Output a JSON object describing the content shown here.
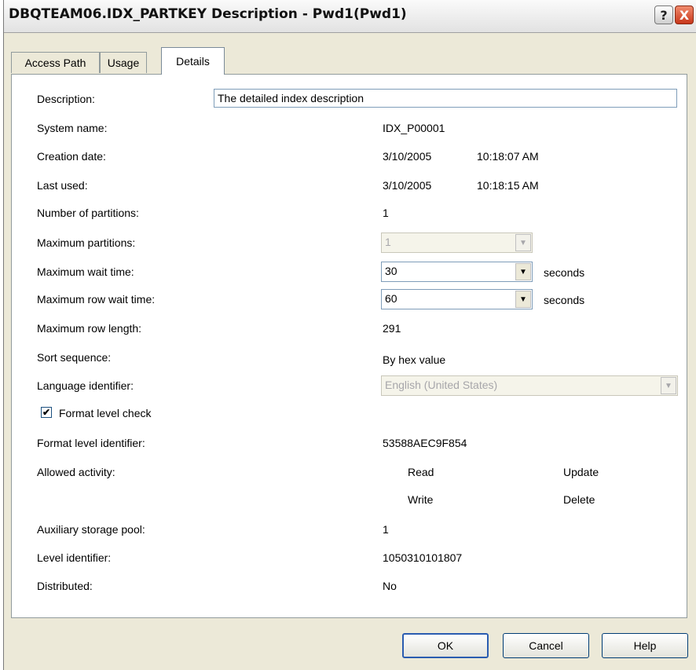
{
  "window": {
    "title": "DBQTEAM06.IDX_PARTKEY Description - Pwd1(Pwd1)",
    "help_glyph": "?",
    "close_glyph": "X"
  },
  "tabs": [
    {
      "label": "Access Path",
      "active": false
    },
    {
      "label": "Usage",
      "active": false
    },
    {
      "label": "Details",
      "active": true
    }
  ],
  "details": {
    "description": {
      "label": "Description:",
      "value": "The detailed index description"
    },
    "system_name": {
      "label": "System name:",
      "value": "IDX_P00001"
    },
    "creation_date": {
      "label": "Creation date:",
      "date": "3/10/2005",
      "time": "10:18:07 AM"
    },
    "last_used": {
      "label": "Last used:",
      "date": "3/10/2005",
      "time": "10:18:15 AM"
    },
    "number_of_partitions": {
      "label": "Number of partitions:",
      "value": "1"
    },
    "maximum_partitions": {
      "label": "Maximum partitions:",
      "value": "1",
      "enabled": false
    },
    "maximum_wait_time": {
      "label": "Maximum wait time:",
      "value": "30",
      "unit": "seconds"
    },
    "maximum_row_wait_time": {
      "label": "Maximum row wait time:",
      "value": "60",
      "unit": "seconds"
    },
    "maximum_row_length": {
      "label": "Maximum row length:",
      "value": "291"
    },
    "sort_sequence": {
      "label": "Sort sequence:",
      "value": "By hex value"
    },
    "language_identifier": {
      "label": "Language identifier:",
      "value": "English (United States)",
      "enabled": false
    },
    "format_level_check": {
      "label": "Format level check",
      "checked": true,
      "mark": "✔"
    },
    "format_level_identifier": {
      "label": "Format level identifier:",
      "value": "53588AEC9F854"
    },
    "allowed_activity": {
      "label": "Allowed activity:",
      "read": "Read",
      "update": "Update",
      "write": "Write",
      "delete": "Delete"
    },
    "auxiliary_storage_pool": {
      "label": "Auxiliary storage pool:",
      "value": "1"
    },
    "level_identifier": {
      "label": "Level identifier:",
      "value": "1050310101807"
    },
    "distributed": {
      "label": "Distributed:",
      "value": "No"
    }
  },
  "buttons": {
    "ok": "OK",
    "cancel": "Cancel",
    "help": "Help"
  },
  "icons": {
    "combo_arrow": "▼"
  },
  "colors": {
    "dialog_background": "#ece9d8",
    "panel_background": "#ffffff",
    "input_border": "#7f9db9",
    "close_button": "#c8361a",
    "disabled_text": "#a7a6aa"
  }
}
